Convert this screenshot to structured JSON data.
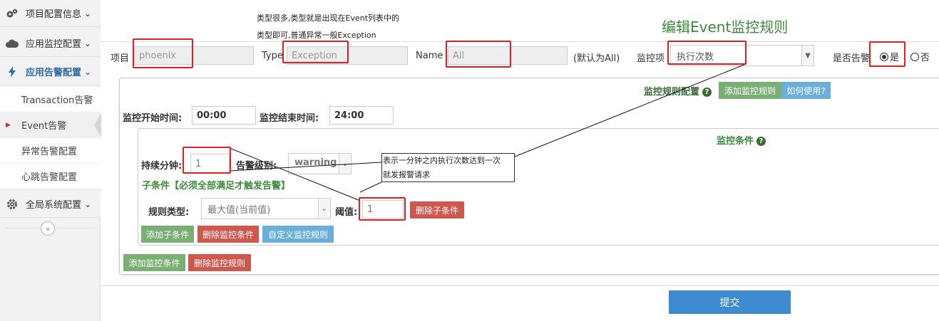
{
  "sidebar": {
    "menus": [
      {
        "label": "项目配置信息",
        "icon": "gears-icon"
      },
      {
        "label": "应用监控配置",
        "icon": "cloud-icon"
      },
      {
        "label": "应用告警配置",
        "icon": "bolt-icon"
      },
      {
        "label": "全局系统配置",
        "icon": "gear-icon"
      }
    ],
    "alert_sub_items": [
      "Transaction告警",
      "Event告警",
      "异常告警配置",
      "心跳告警配置"
    ],
    "collapse_glyph": "«"
  },
  "annotations": {
    "type_hint_line1": "类型很多,类型就是出现在Event列表中的",
    "type_hint_line2": "类型即可,普通异常一般Exception",
    "page_title": "编辑Event监控规则",
    "callout_line1": "表示一分钟之内执行次数达到一次",
    "callout_line2": "就发报警请求"
  },
  "filters": {
    "project_label": "项目",
    "project_value": "phoenix",
    "type_label": "Type",
    "type_value": "Exception",
    "name_label": "Name",
    "name_value": "All",
    "name_default_note": "(默认为All)",
    "monitor_item_label": "监控项",
    "monitor_item_value": "执行次数",
    "alert_label": "是否告警",
    "alert_yes": "是",
    "alert_no": "否",
    "alert_selected": "yes"
  },
  "rule": {
    "section_title": "监控规则配置",
    "add_rule_button": "添加监控规则",
    "how_to_button": "如何使用?",
    "start_time_label": "监控开始时间:",
    "start_time_value": "00:00",
    "end_time_label": "监控结束时间:",
    "end_time_value": "24:00",
    "condition_title": "监控条件",
    "duration_label": "持续分钟:",
    "duration_value": "1",
    "level_label": "告警级别:",
    "level_value": "warning",
    "subcondition_title": "子条件【必须全部满足才触发告警】",
    "rule_type_label": "规则类型:",
    "rule_type_value": "最大值(当前值)",
    "threshold_label": "阈值:",
    "threshold_value": "1",
    "delete_sub_button": "删除子条件",
    "add_sub_button": "添加子条件",
    "delete_condition_button": "删除监控条件",
    "custom_rule_button": "自定义监控规则",
    "add_condition_button": "添加监控条件",
    "delete_rule_button": "删除监控规则"
  },
  "submit_button": "提交",
  "colors": {
    "annotation_red": "#e02020",
    "title_green": "#3c8a3c",
    "button_green": "#7aaf73",
    "button_blue": "#6aaedc",
    "button_red": "#d0574e",
    "submit_blue": "#3f8bcf"
  }
}
